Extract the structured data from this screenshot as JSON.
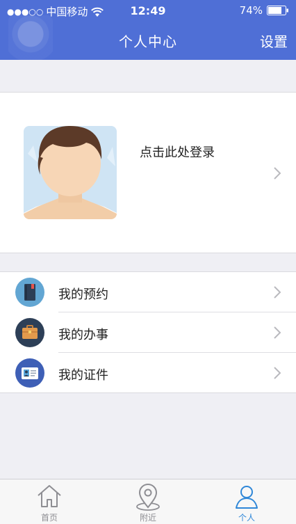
{
  "status_bar": {
    "signal": "●●●○○",
    "carrier": "中国移动",
    "time": "12:49",
    "battery": "74%"
  },
  "nav": {
    "title": "个人中心",
    "settings_label": "设置"
  },
  "profile": {
    "login_prompt": "点击此处登录"
  },
  "menu": {
    "items": [
      {
        "label": "我的预约",
        "icon": "notebook-icon"
      },
      {
        "label": "我的办事",
        "icon": "briefcase-icon"
      },
      {
        "label": "我的证件",
        "icon": "id-card-icon"
      }
    ]
  },
  "tabs": [
    {
      "label": "首页",
      "icon": "home-icon"
    },
    {
      "label": "附近",
      "icon": "location-pin-icon"
    },
    {
      "label": "个人",
      "icon": "person-icon",
      "active": true
    }
  ],
  "colors": {
    "header": "#4f6fd6",
    "active_tab": "#2f87d8",
    "background": "#efeff4"
  }
}
